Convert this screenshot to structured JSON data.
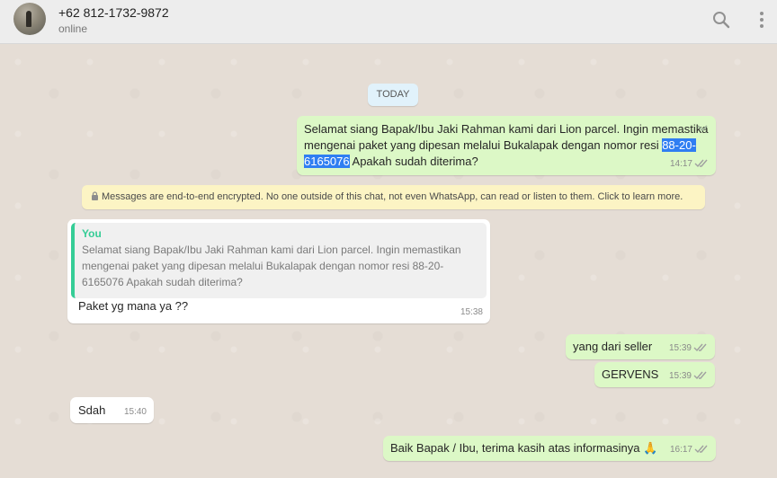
{
  "header": {
    "contact_name": "+62 812-1732-9872",
    "status": "online",
    "icons": [
      "avatar",
      "search-icon",
      "menu-icon"
    ]
  },
  "chat": {
    "date_label": "TODAY",
    "encryption_notice": "Messages are end-to-end encrypted. No one outside of this chat, not even WhatsApp, can read or listen to them. Click to learn more.",
    "messages": [
      {
        "direction": "outgoing",
        "text_part1": "Selamat siang Bapak/Ibu Jaki Rahman kami dari Lion parcel. Ingin memastika",
        "text_part2": "mengenai paket yang dipesan melalui Bukalapak dengan nomor resi ",
        "highlight_a": "88-20-",
        "highlight_b": "6165076",
        "text_part3": " Apakah sudah diterima?",
        "time": "14:17",
        "status": "read"
      },
      {
        "direction": "incoming",
        "quote_author": "You",
        "quote_text": "Selamat siang Bapak/Ibu Jaki Rahman kami dari Lion parcel. Ingin memastikan mengenai paket yang dipesan melalui Bukalapak dengan nomor resi 88-20-6165076 Apakah sudah diterima?",
        "text": "Paket yg mana ya ??",
        "time": "15:38"
      },
      {
        "direction": "outgoing",
        "text": "yang dari seller",
        "time": "15:39",
        "status": "read"
      },
      {
        "direction": "outgoing",
        "text": "GERVENS",
        "time": "15:39",
        "status": "read"
      },
      {
        "direction": "incoming",
        "text": "Sdah",
        "time": "15:40"
      },
      {
        "direction": "outgoing",
        "text": "Baik Bapak / Ibu, terima kasih atas informasinya 🙏",
        "time": "16:17",
        "status": "read"
      }
    ]
  },
  "colors": {
    "outgoing_bubble": "#dcf8c6",
    "incoming_bubble": "#ffffff",
    "quote_accent": "#35cd96",
    "selection": "#2f7ef2",
    "encryption_bg": "#fcf4c4"
  }
}
